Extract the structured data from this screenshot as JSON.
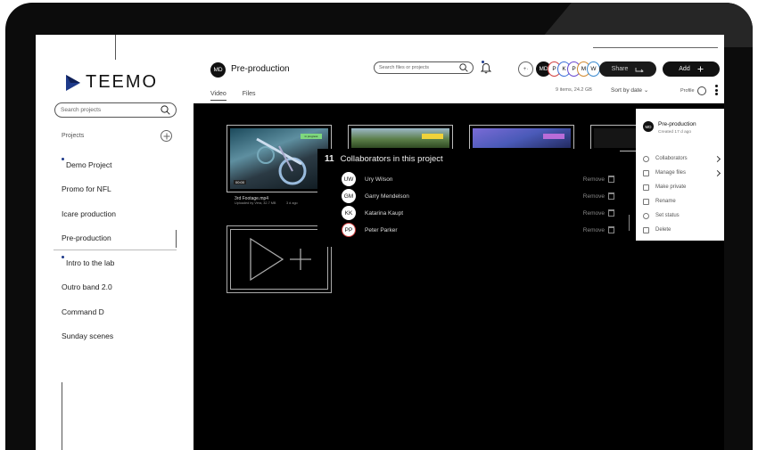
{
  "brand": {
    "name": "TEEMO"
  },
  "sidebar": {
    "search_placeholder": "Search projects",
    "projects_label": "Projects",
    "items": [
      {
        "label": "Demo Project",
        "dot": true
      },
      {
        "label": "Promo for NFL",
        "dot": false
      },
      {
        "label": "Icare production",
        "dot": false
      },
      {
        "label": "Pre-production",
        "dot": false,
        "active": true
      },
      {
        "label": "Intro to the lab",
        "dot": true
      },
      {
        "label": "Outro band 2.0",
        "dot": false
      },
      {
        "label": "Command D",
        "dot": false
      },
      {
        "label": "Sunday scenes",
        "dot": false
      }
    ]
  },
  "header": {
    "avatar": "MD",
    "title": "Pre-production",
    "tabs": [
      "Video",
      "Files"
    ],
    "search_placeholder": "Search files or projects",
    "add_user_icon": "+·",
    "collaborators": [
      {
        "initials": "MD",
        "color": "#111111"
      },
      {
        "initials": "P",
        "color": "#d04040"
      },
      {
        "initials": "K",
        "color": "#3a6fd8"
      },
      {
        "initials": "P",
        "color": "#6a4ad0"
      },
      {
        "initials": "M",
        "color": "#d08a30"
      },
      {
        "initials": "W",
        "color": "#3a8ad0"
      }
    ],
    "share_label": "Share",
    "add_label": "Add",
    "meta": "9 items, 24.2 GB",
    "sort_label": "Sort by date",
    "profile_label": "Profile"
  },
  "thumbs": {
    "t1_badge": "in progress",
    "t1_time": "00:00",
    "t1_caption": "3rd Footage.mp4",
    "t1_sub": "Uploaded by Vera, 32.7 MB",
    "t1_age": "3 d ago",
    "t1_cut": "8 D"
  },
  "collab_panel": {
    "count": "11",
    "title": "Collaborators in this project",
    "remove_label": "Remove",
    "people": [
      {
        "initials": "UW",
        "name": "Ury Wilson"
      },
      {
        "initials": "GM",
        "name": "Garry Mendelson"
      },
      {
        "initials": "KK",
        "name": "Katarina Kaupt"
      },
      {
        "initials": "PP",
        "name": "Peter Parker"
      }
    ]
  },
  "menu": {
    "avatar": "MD",
    "title": "Pre-production",
    "subtitle": "Created 17 d ago",
    "items": [
      {
        "label": "Collaborators",
        "icon": "people-icon",
        "chevron": true
      },
      {
        "label": "Manage files",
        "icon": "file-icon",
        "chevron": true
      },
      {
        "label": "Make private",
        "icon": "lock-file-icon",
        "chevron": false
      },
      {
        "label": "Rename",
        "icon": "pencil-icon",
        "chevron": false
      },
      {
        "label": "Set status",
        "icon": "status-icon",
        "chevron": false
      },
      {
        "label": "Delete",
        "icon": "trash-icon",
        "chevron": false
      }
    ]
  }
}
